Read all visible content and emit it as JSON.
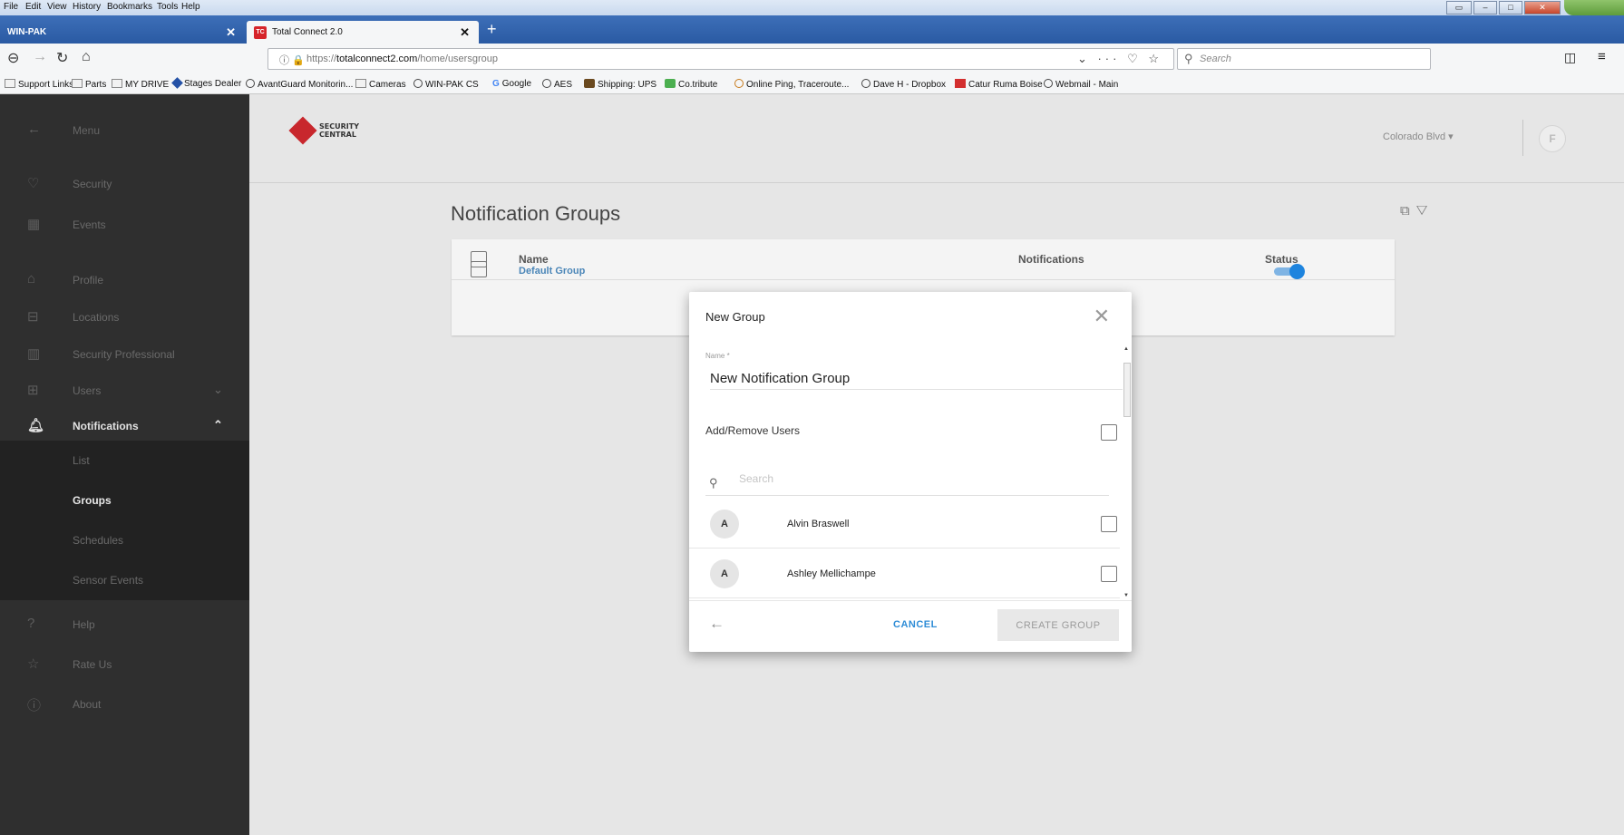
{
  "browser": {
    "menus": [
      "File",
      "Edit",
      "View",
      "History",
      "Bookmarks",
      "Tools",
      "Help"
    ],
    "tabs": [
      {
        "label": "WIN-PAK"
      },
      {
        "label": "Total Connect 2.0",
        "favicon": "TC"
      }
    ],
    "url_prefix": "https://",
    "url_domain": "totalconnect2.com",
    "url_path": "/home/usersgroup",
    "search_placeholder": "Search",
    "bookmarks": [
      "Support Links",
      "Parts",
      "MY DRIVE",
      "Stages Dealer",
      "AvantGuard Monitorin...",
      "Cameras",
      "WIN-PAK CS",
      "Google",
      "AES",
      "Shipping: UPS",
      "Co.tribute",
      "Online Ping, Traceroute...",
      "Dave H - Dropbox",
      "Catur Ruma Boise",
      "Webmail - Main"
    ]
  },
  "sidebar": {
    "menu_label": "Menu",
    "items": [
      {
        "label": "Security",
        "icon": "shield-icon"
      },
      {
        "label": "Events",
        "icon": "calendar-icon"
      },
      {
        "label": "Profile",
        "icon": "profile-icon"
      },
      {
        "label": "Locations",
        "icon": "locations-icon"
      },
      {
        "label": "Security Professional",
        "icon": "building-icon"
      },
      {
        "label": "Users",
        "icon": "users-icon"
      },
      {
        "label": "Notifications",
        "icon": "bell-icon"
      }
    ],
    "notification_subitems": [
      "List",
      "Groups",
      "Schedules",
      "Sensor Events"
    ],
    "bottom_items": [
      {
        "label": "Help",
        "icon": "question-icon"
      },
      {
        "label": "Rate Us",
        "icon": "star-icon"
      },
      {
        "label": "About",
        "icon": "info-icon"
      }
    ]
  },
  "header": {
    "logo_line1": "SECURITY",
    "logo_line2": "CENTRAL",
    "location": "Colorado Blvd",
    "avatar_initial": "F"
  },
  "main": {
    "title": "Notification Groups",
    "columns": [
      "Name",
      "Notifications",
      "Status"
    ],
    "rows": [
      {
        "name": "Default Group",
        "status_on": true
      }
    ]
  },
  "dialog": {
    "title": "New Group",
    "name_label": "Name *",
    "name_value": "New Notification Group",
    "add_remove_label": "Add/Remove Users",
    "search_placeholder": "Search",
    "users": [
      {
        "initial": "A",
        "name": "Alvin Braswell"
      },
      {
        "initial": "A",
        "name": "Ashley Mellichampe"
      }
    ],
    "cancel_label": "CANCEL",
    "create_label": "CREATE GROUP"
  },
  "colors": {
    "sidebar_bg": "#2f2f2f",
    "accent_blue": "#2e8cd6",
    "toggle_on": "#1e84de",
    "link_blue": "#4b86b8",
    "brand_red": "#c8272d"
  }
}
